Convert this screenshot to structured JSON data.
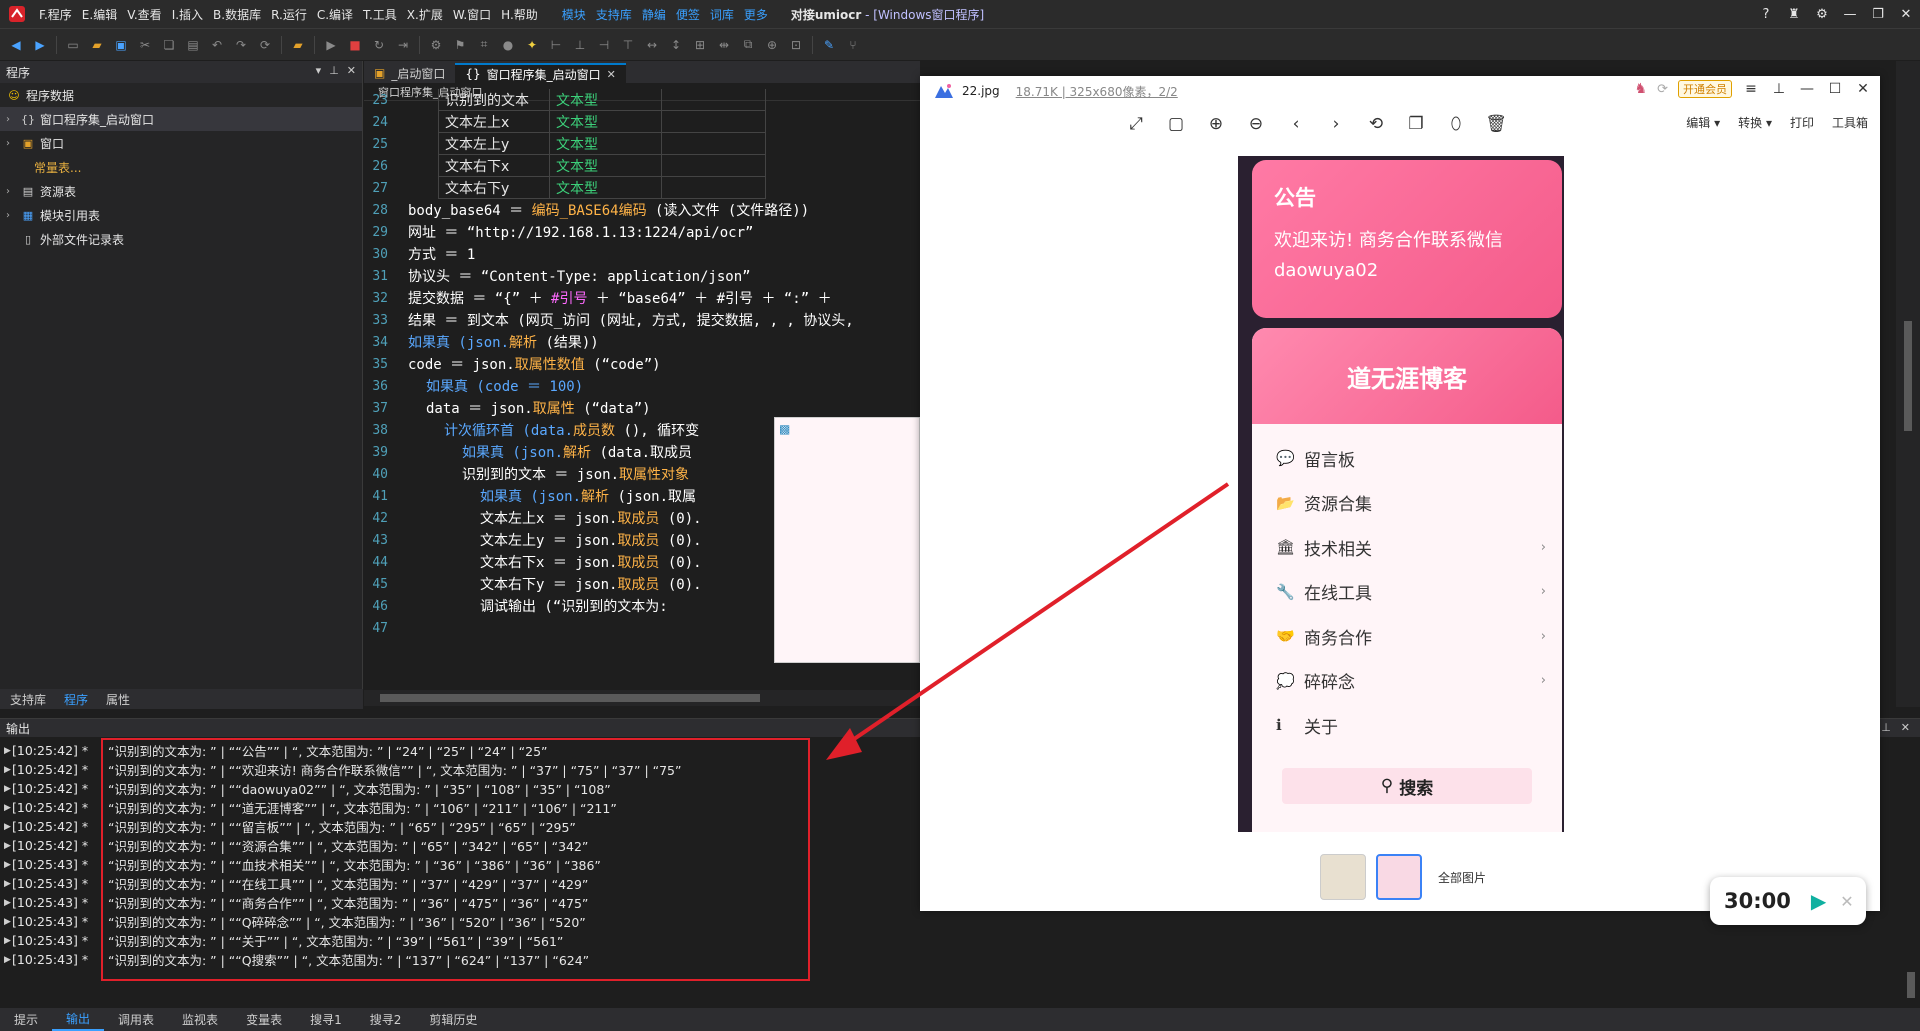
{
  "menubar": {
    "items": [
      "F.程序",
      "E.编辑",
      "V.查看",
      "I.插入",
      "B.数据库",
      "R.运行",
      "C.编译",
      "T.工具",
      "X.扩展",
      "W.窗口",
      "H.帮助"
    ],
    "links": [
      "模块",
      "支持库",
      "静编",
      "便签",
      "词库",
      "更多"
    ],
    "title_main": "对接umiocr",
    "title_sub": " - [Windows窗口程序]"
  },
  "left_panel": {
    "header": "程序",
    "items": [
      {
        "label": "程序数据"
      },
      {
        "label": "窗口程序集_启动窗口"
      },
      {
        "label": "窗口"
      },
      {
        "label": "常量表..."
      },
      {
        "label": "资源表"
      },
      {
        "label": "模块引用表"
      },
      {
        "label": "外部文件记录表"
      }
    ],
    "tabs": [
      "支持库",
      "程序",
      "属性"
    ]
  },
  "editor": {
    "tabs": [
      {
        "label": "_启动窗口"
      },
      {
        "label": "窗口程序集_启动窗口"
      }
    ],
    "breadcrumb": "窗口程序集_启动窗口",
    "var_rows": [
      {
        "name": "识别到的文本",
        "type": "文本型"
      },
      {
        "name": "文本左上x",
        "type": "文本型"
      },
      {
        "name": "文本左上y",
        "type": "文本型"
      },
      {
        "name": "文本右下x",
        "type": "文本型"
      },
      {
        "name": "文本右下y",
        "type": "文本型"
      }
    ],
    "line_numbers": [
      "23",
      "24",
      "25",
      "26",
      "27",
      "28",
      "29",
      "30",
      "31",
      "32",
      "33",
      "34",
      "35",
      "36",
      "37",
      "38",
      "39",
      "40",
      "41",
      "42",
      "43",
      "44",
      "45",
      "46",
      "47"
    ],
    "code_lines": [
      {
        "pre": "body_base64 ＝ ",
        "fn": "编码_BASE64编码",
        "post": " (读入文件 (文件路径))"
      },
      {
        "pre": "网址 ＝ “http://192.168.1.13:1224/api/ocr”",
        "fn": "",
        "post": ""
      },
      {
        "pre": "方式 ＝ 1",
        "fn": "",
        "post": ""
      },
      {
        "pre": "协议头 ＝ “Content-Type: application/json”",
        "fn": "",
        "post": ""
      },
      {
        "pre": "提交数据 ＝ “{” ＋ ",
        "fn": "#引号",
        "post": " ＋ “base64” ＋ #引号 ＋ “:” ＋"
      },
      {
        "pre": "结果 ＝ 到文本 (网页_访问 (网址, 方式, 提交数据, , , 协议头,",
        "fn": "",
        "post": ""
      },
      {
        "pre": "如果真 (json.",
        "fn": "解析",
        "post": " (结果))"
      },
      {
        "pre": "code ＝ json.",
        "fn": "取属性数值",
        "post": " (“code”)"
      },
      {
        "pre": "如果真 (code ＝ 100)",
        "fn": "",
        "post": ""
      },
      {
        "pre": "data ＝ json.",
        "fn": "取属性",
        "post": " (“data”)"
      },
      {
        "pre": "计次循环首 (data.",
        "fn": "成员数",
        "post": " (), 循环变"
      },
      {
        "pre": "如果真 (json.",
        "fn": "解析",
        "post": " (data.取成员"
      },
      {
        "pre": "识别到的文本 ＝ json.",
        "fn": "取属性对象",
        "post": ""
      },
      {
        "pre": "如果真 (json.",
        "fn": "解析",
        "post": " (json.取属"
      },
      {
        "pre": "文本左上x ＝ json.",
        "fn": "取成员",
        "post": " (0)."
      },
      {
        "pre": "文本左上y ＝ json.",
        "fn": "取成员",
        "post": " (0)."
      },
      {
        "pre": "文本右下x ＝ json.",
        "fn": "取成员",
        "post": " (0)."
      },
      {
        "pre": "文本右下y ＝ json.",
        "fn": "取成员",
        "post": " (0)."
      },
      {
        "pre": "调试输出 (“识别到的文本为:",
        "fn": "",
        "post": ""
      }
    ]
  },
  "output": {
    "header": "输出",
    "lines": [
      {
        "time": "[10:25:42] *",
        "text": "“识别到的文本为: ” | ““公告”” | “, 文本范围为: ” | “24” | “25” | “24” | “25”"
      },
      {
        "time": "[10:25:42] *",
        "text": "“识别到的文本为: ” | ““欢迎来访! 商务合作联系微信”” | “, 文本范围为: ” | “37” | “75” | “37” | “75”"
      },
      {
        "time": "[10:25:42] *",
        "text": "“识别到的文本为: ” | ““daowuya02”” | “, 文本范围为: ” | “35” | “108” | “35” | “108”"
      },
      {
        "time": "[10:25:42] *",
        "text": "“识别到的文本为: ” | ““道无涯博客”” | “, 文本范围为: ” | “106” | “211” | “106” | “211”"
      },
      {
        "time": "[10:25:42] *",
        "text": "“识别到的文本为: ” | ““留言板”” | “, 文本范围为: ” | “65” | “295” | “65” | “295”"
      },
      {
        "time": "[10:25:42] *",
        "text": "“识别到的文本为: ” | ““资源合集”” | “, 文本范围为: ” | “65” | “342” | “65” | “342”"
      },
      {
        "time": "[10:25:43] *",
        "text": "“识别到的文本为: ” | ““血技术相关”” | “, 文本范围为: ” | “36” | “386” | “36” | “386”"
      },
      {
        "time": "[10:25:43] *",
        "text": "“识别到的文本为: ” | ““在线工具”” | “, 文本范围为: ” | “37” | “429” | “37” | “429”"
      },
      {
        "time": "[10:25:43] *",
        "text": "“识别到的文本为: ” | ““商务合作”” | “, 文本范围为: ” | “36” | “475” | “36” | “475”"
      },
      {
        "time": "[10:25:43] *",
        "text": "“识别到的文本为: ” | ““Q碎碎念”” | “, 文本范围为: ” | “36” | “520” | “36” | “520”"
      },
      {
        "time": "[10:25:43] *",
        "text": "“识别到的文本为: ” | ““关于”” | “, 文本范围为: ” | “39” | “561” | “39” | “561”"
      },
      {
        "time": "[10:25:43] *",
        "text": "“识别到的文本为: ” | ““Q搜索”” | “, 文本范围为: ” | “137” | “624” | “137” | “624”"
      }
    ]
  },
  "bottom_tabs": [
    "提示",
    "输出",
    "调用表",
    "监视表",
    "变量表",
    "搜寻1",
    "搜寻2",
    "剪辑历史"
  ],
  "viewer": {
    "filename": "22.jpg",
    "info": "18.71K | 325x680像素，2/2",
    "vip": "开通会员",
    "tools_right": [
      "编辑 ▾",
      "转换 ▾",
      "打印",
      "工具箱"
    ],
    "notice_title": "公告",
    "notice_line1": "欢迎来访! 商务合作联系微信",
    "notice_line2": "daowuya02",
    "blog_title": "道无涯博客",
    "menu_items": [
      {
        "icon": "💬",
        "label": "留言板",
        "arrow": ""
      },
      {
        "icon": "📂",
        "label": "资源合集",
        "arrow": ""
      },
      {
        "icon": "🏛",
        "label": "技术相关",
        "arrow": "›"
      },
      {
        "icon": "🔧",
        "label": "在线工具",
        "arrow": "›"
      },
      {
        "icon": "🤝",
        "label": "商务合作",
        "arrow": "›"
      },
      {
        "icon": "💭",
        "label": "碎碎念",
        "arrow": "›"
      },
      {
        "icon": "ℹ",
        "label": "关于",
        "arrow": ""
      }
    ],
    "search_label": "搜索",
    "all_images": "全部图片"
  },
  "timer": {
    "value": "30:00"
  },
  "colors": {
    "accent": "#007acc",
    "highlight_box": "#e0202a",
    "pink": "#f45b8a"
  }
}
